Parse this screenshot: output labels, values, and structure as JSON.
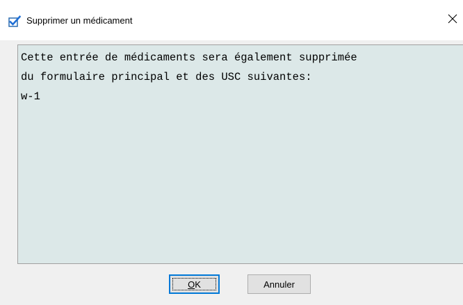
{
  "window": {
    "title": "Supprimer un médicament",
    "title_icon": "checkmark-icon",
    "close_icon": "close-icon"
  },
  "message": {
    "lines": [
      "Cette entrée de médicaments sera également supprimée",
      "du formulaire principal et des USC suivantes:",
      "w-1"
    ]
  },
  "buttons": {
    "ok_label": "OK",
    "cancel_label": "Annuler"
  },
  "colors": {
    "message_background": "#dce8e8",
    "dialog_background": "#f0f0f0",
    "accent": "#0078d7"
  }
}
